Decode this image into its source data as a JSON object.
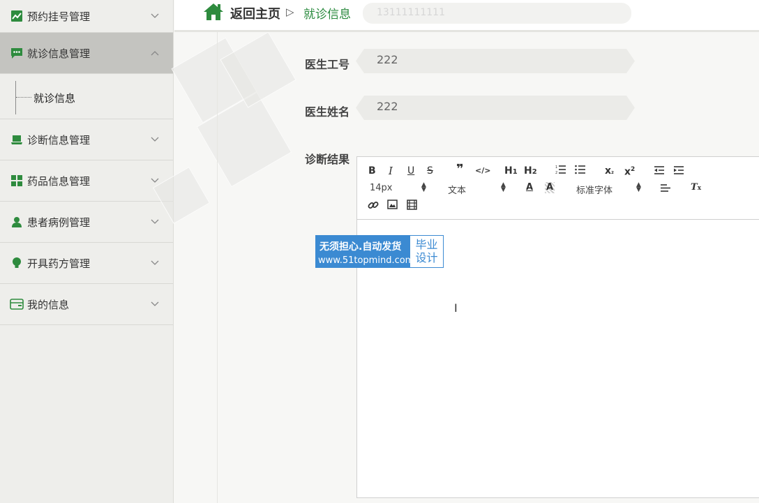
{
  "sidebar": {
    "items": [
      {
        "label": "预约挂号管理",
        "icon": "chart-line-icon"
      },
      {
        "label": "就诊信息管理",
        "icon": "message-icon",
        "expanded": true,
        "sub": [
          "就诊信息"
        ]
      },
      {
        "label": "诊断信息管理",
        "icon": "monitor-icon"
      },
      {
        "label": "药品信息管理",
        "icon": "grid-icon"
      },
      {
        "label": "患者病例管理",
        "icon": "user-icon"
      },
      {
        "label": "开具药方管理",
        "icon": "bulb-icon"
      },
      {
        "label": "我的信息",
        "icon": "card-icon"
      }
    ]
  },
  "header": {
    "home": "返回主页",
    "separator": "▷",
    "current": "就诊信息",
    "ghost_value": "13111111111"
  },
  "form": {
    "doctor_id_label": "医生工号",
    "doctor_id_value": "222",
    "doctor_name_label": "医生姓名",
    "doctor_name_value": "222",
    "diagnosis_label": "诊断结果"
  },
  "editor": {
    "font_size": "14px",
    "format": "文本",
    "font_family": "标准字体",
    "content": ""
  },
  "watermark": {
    "line1": "无须担心.自动发货",
    "line2": "www.51topmind.com",
    "right1": "毕业",
    "right2": "设计"
  },
  "colors": {
    "accent": "#2a8a3e",
    "sidebar_bg": "#eeeeeb",
    "active_bg": "#c4c4c0",
    "watermark": "#3b8ad2"
  }
}
